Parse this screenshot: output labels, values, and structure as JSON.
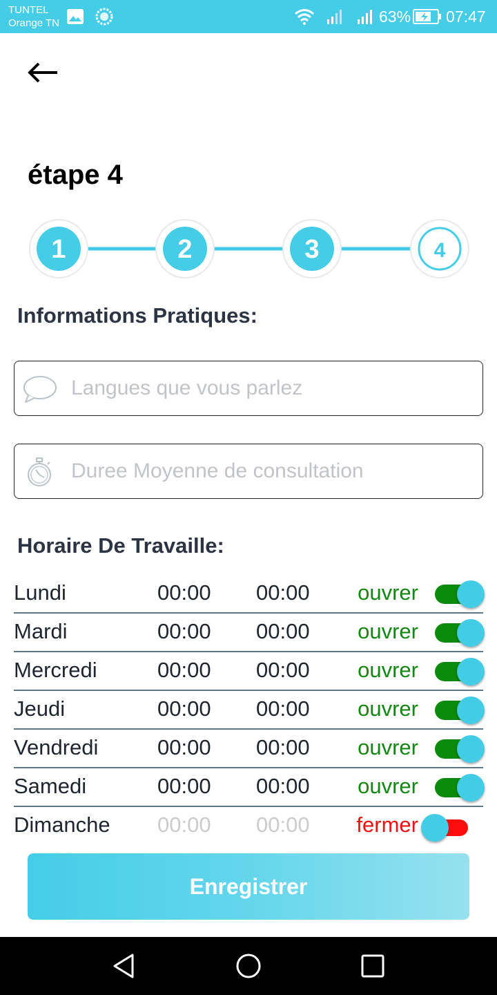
{
  "status_bar": {
    "carrier_line1": "TUNTEL",
    "carrier_line2": "Orange TN",
    "battery": "63%",
    "time": "07:47",
    "icons": [
      "gallery-icon",
      "sync-icon",
      "wifi-icon",
      "signal-icon",
      "signal-icon",
      "battery-charging-icon"
    ]
  },
  "header": {
    "back_icon": "arrow-left-icon",
    "title": "étape 4"
  },
  "stepper": {
    "steps": [
      "1",
      "2",
      "3",
      "4"
    ],
    "current_step": 4,
    "accent_color": "#45cde7"
  },
  "practical_info": {
    "title": "Informations Pratiques:",
    "languages": {
      "icon": "speech-bubble-icon",
      "placeholder": "Langues que vous parlez",
      "value": ""
    },
    "duration": {
      "icon": "stopwatch-icon",
      "placeholder": "Duree Moyenne de consultation",
      "value": ""
    }
  },
  "schedule": {
    "title": "Horaire De Travaille:",
    "rows": [
      {
        "day": "Lundi",
        "start": "00:00",
        "end": "00:00",
        "status": "ouvrer",
        "open": true
      },
      {
        "day": "Mardi",
        "start": "00:00",
        "end": "00:00",
        "status": "ouvrer",
        "open": true
      },
      {
        "day": "Mercredi",
        "start": "00:00",
        "end": "00:00",
        "status": "ouvrer",
        "open": true
      },
      {
        "day": "Jeudi",
        "start": "00:00",
        "end": "00:00",
        "status": "ouvrer",
        "open": true
      },
      {
        "day": "Vendredi",
        "start": "00:00",
        "end": "00:00",
        "status": "ouvrer",
        "open": true
      },
      {
        "day": "Samedi",
        "start": "00:00",
        "end": "00:00",
        "status": "ouvrer",
        "open": true
      },
      {
        "day": "Dimanche",
        "start": "00:00",
        "end": "00:00",
        "status": "fermer",
        "open": false
      }
    ],
    "open_color": "#118811",
    "closed_color": "#ee1111"
  },
  "actions": {
    "save_label": "Enregistrer"
  },
  "nav_bar": {
    "icons": [
      "back-triangle-icon",
      "home-circle-icon",
      "recents-square-icon"
    ]
  }
}
